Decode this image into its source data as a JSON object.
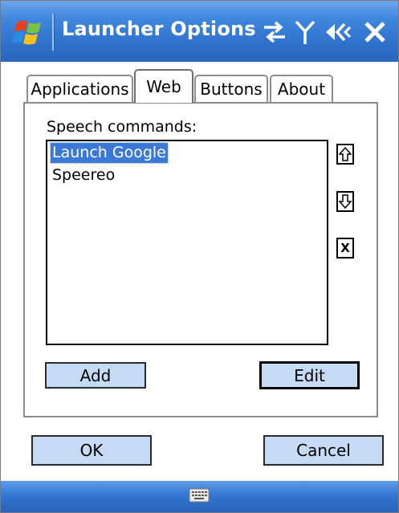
{
  "window": {
    "title": "Launcher Options",
    "close_label": "X"
  },
  "tabs": [
    {
      "label": "Applications",
      "active": false
    },
    {
      "label": "Web",
      "active": true
    },
    {
      "label": "Buttons",
      "active": false
    },
    {
      "label": "About",
      "active": false
    }
  ],
  "web_tab": {
    "list_label": "Speech commands:",
    "list_items": [
      {
        "label": "Launch Google",
        "selected": true
      },
      {
        "label": "Speereo",
        "selected": false
      }
    ],
    "side_buttons": {
      "move_up_icon": "arrow-up-icon",
      "move_down_icon": "arrow-down-icon",
      "delete_label": "X"
    },
    "add_label": "Add",
    "edit_label": "Edit"
  },
  "footer": {
    "ok_label": "OK",
    "cancel_label": "Cancel"
  },
  "colors": {
    "titlebar": "#3f86dc",
    "selection": "#3c78d6",
    "button_fill": "#c5dbf3"
  }
}
